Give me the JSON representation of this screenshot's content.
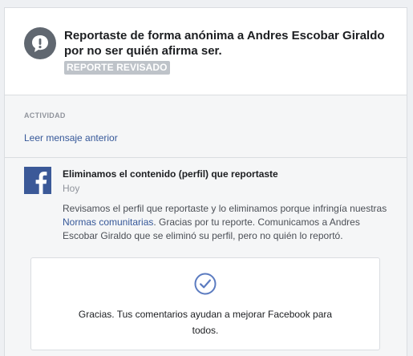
{
  "report": {
    "title": "Reportaste de forma anónima a Andres Escobar Giraldo por no ser quién afirma ser.",
    "status_badge": "REPORTE REVISADO",
    "icon": "alert-icon"
  },
  "activity": {
    "label": "ACTIVIDAD",
    "previous_message_link": "Leer mensaje anterior"
  },
  "message": {
    "sender_logo": "facebook-logo-icon",
    "title": "Eliminamos el contenido (perfil) que reportaste",
    "date": "Hoy",
    "body_part1": "Revisamos el perfil que reportaste y lo eliminamos porque infringía nuestras ",
    "body_link": "Normas comunitarias",
    "body_part2": ". Gracias por tu reporte. Comunicamos a Andres Escobar Giraldo que se eliminó su perfil, pero no quién lo reportó."
  },
  "feedback": {
    "icon": "check-circle-icon",
    "text": "Gracias. Tus comentarios ayudan a mejorar Facebook para todos."
  },
  "colors": {
    "brand": "#3b5998",
    "link": "#365899",
    "badge": "#bec3c9"
  }
}
